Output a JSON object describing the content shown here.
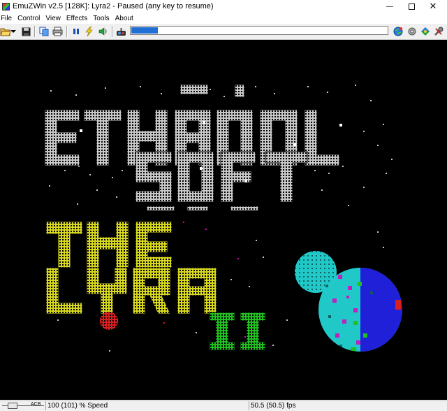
{
  "window": {
    "title": "EmuZWin v2.5 [128K]: Lyra2 - Paused (any key to resume)",
    "controls": {
      "minimize": "—",
      "close": "✕"
    }
  },
  "menu": [
    "File",
    "Control",
    "View",
    "Effects",
    "Tools",
    "About"
  ],
  "toolbar": {
    "icons": [
      "open-folder-icon",
      "chevron-down-icon",
      "save-icon",
      "copy-icon",
      "print-icon",
      "pause-icon",
      "lightning-icon",
      "sound-icon",
      "joystick-icon",
      "globe-icon",
      "settings-icon",
      "colors-icon",
      "tools-icon"
    ],
    "progress_fraction": 0.11,
    "accent": "#1f6fd6"
  },
  "status": {
    "slider_label": "ACB",
    "speed": "100 (101) % Speed",
    "fps": "50.5 (50.5) fps"
  },
  "colors": {
    "screen_background": "#000000",
    "logo_grey": "#c8c8c8",
    "title_yellow": "#d8d820",
    "title_green": "#20c020",
    "planet_cyan": "#20c8c8",
    "planet_blue": "#2020d8",
    "planet_magenta": "#c020c0",
    "small_planet_red": "#d82020"
  }
}
